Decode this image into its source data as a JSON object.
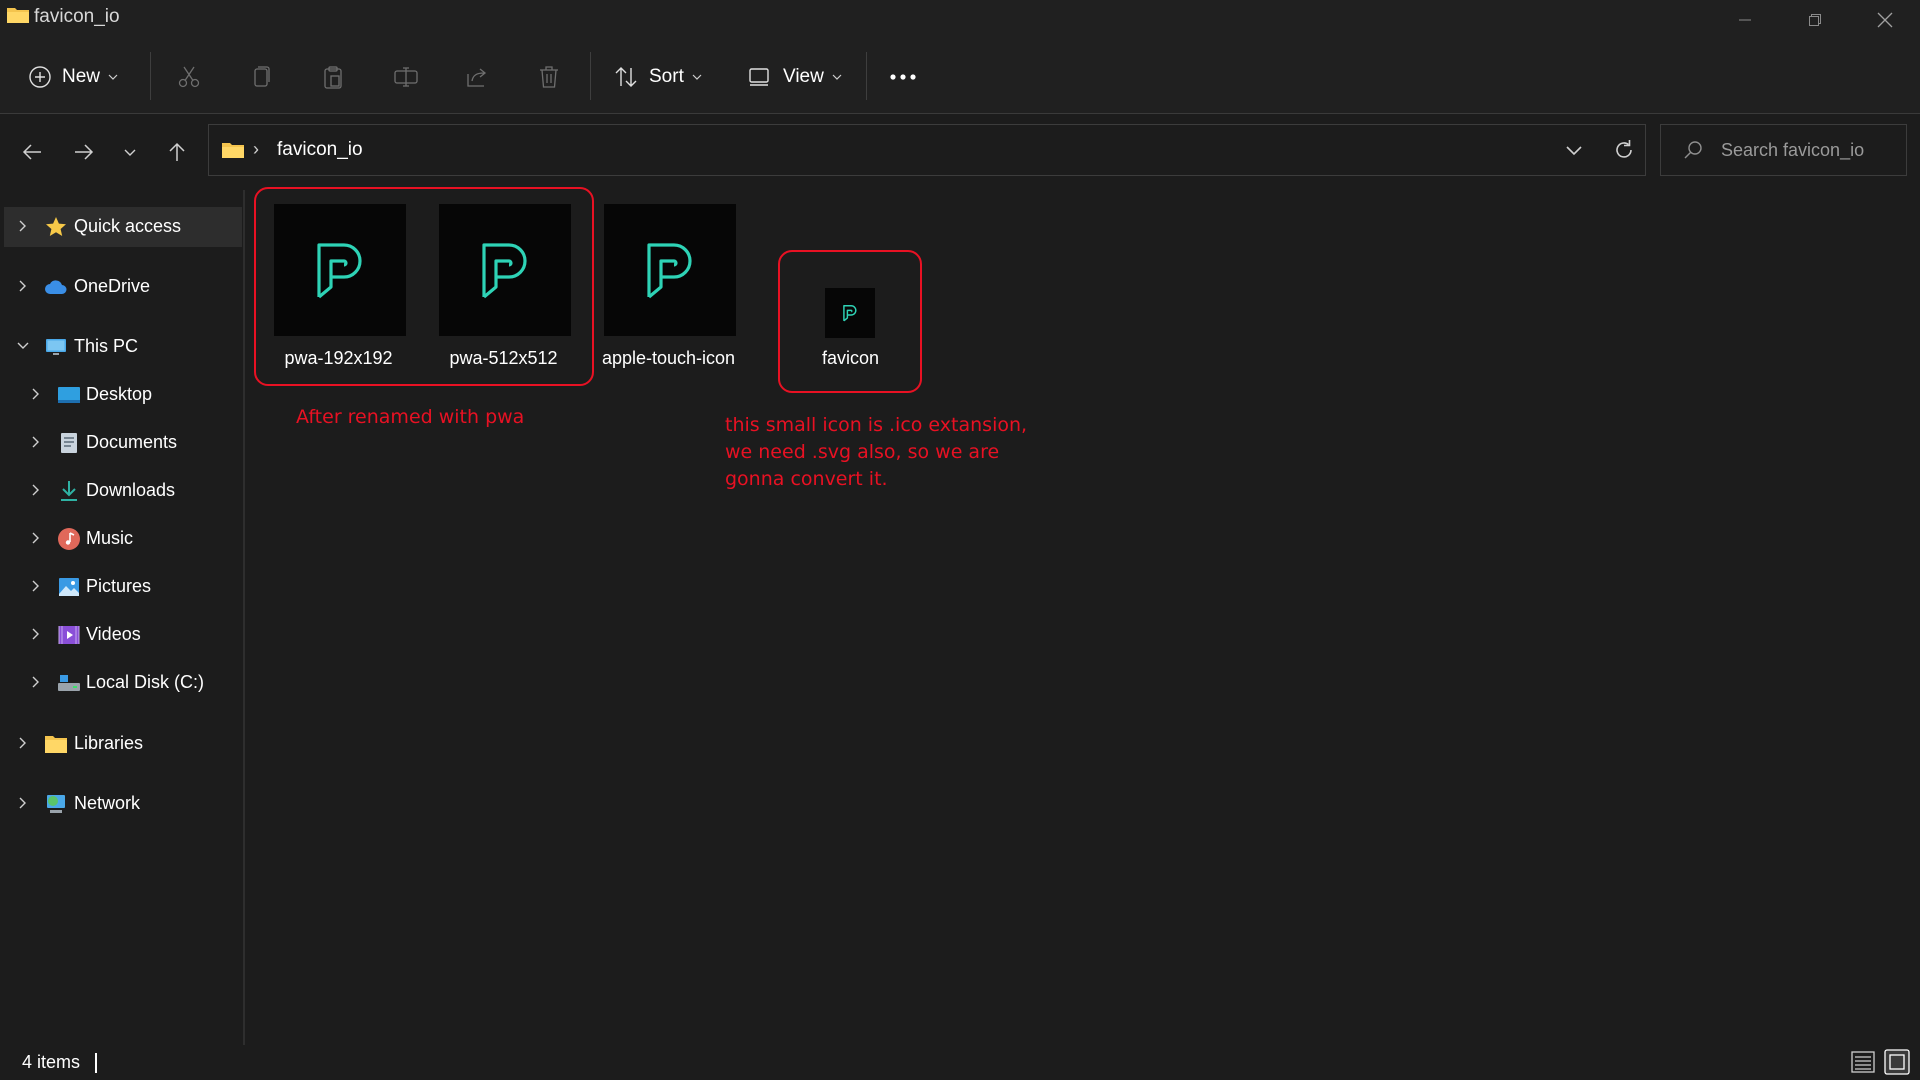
{
  "window": {
    "title": "favicon_io"
  },
  "toolbar": {
    "new_label": "New",
    "sort_label": "Sort",
    "view_label": "View"
  },
  "address": {
    "separator": "›",
    "path": "favicon_io",
    "search_placeholder": "Search favicon_io"
  },
  "sidebar": {
    "items": [
      {
        "label": "Quick access"
      },
      {
        "label": "OneDrive"
      },
      {
        "label": "This PC"
      },
      {
        "label": "Desktop"
      },
      {
        "label": "Documents"
      },
      {
        "label": "Downloads"
      },
      {
        "label": "Music"
      },
      {
        "label": "Pictures"
      },
      {
        "label": "Videos"
      },
      {
        "label": "Local Disk (C:)"
      },
      {
        "label": "Libraries"
      },
      {
        "label": "Network"
      }
    ]
  },
  "files": [
    {
      "name": "pwa-192x192"
    },
    {
      "name": "pwa-512x512"
    },
    {
      "name": "apple-touch-icon"
    },
    {
      "name": "favicon"
    }
  ],
  "annotations": {
    "renamed_note": "After renamed with pwa",
    "ico_note_line1": "this small icon is .ico extansion,",
    "ico_note_line2": "we need .svg also, so we are",
    "ico_note_line3": "gonna convert it."
  },
  "status": {
    "item_count": "4 items"
  },
  "colors": {
    "background": "#1c1c1c",
    "chrome": "#202020",
    "annotation": "#e81123",
    "logo_teal": "#2ed3b6"
  }
}
